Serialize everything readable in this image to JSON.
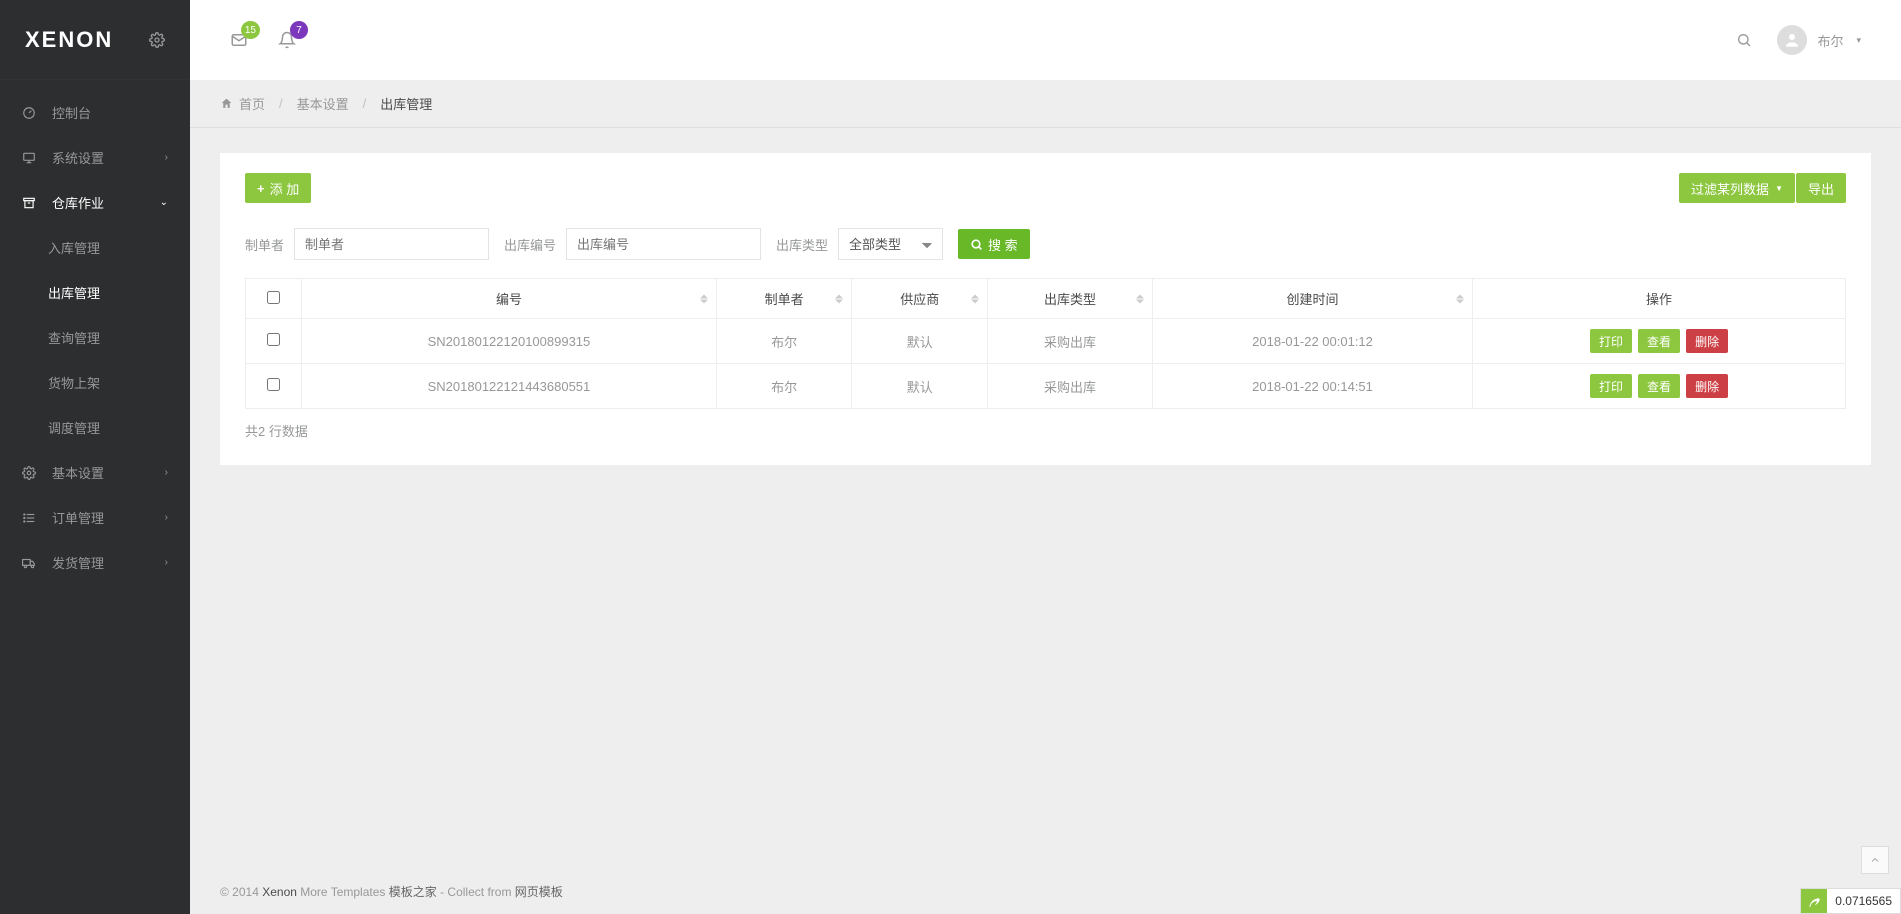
{
  "brand": "XENON",
  "notifications": {
    "mail_count": "15",
    "bell_count": "7"
  },
  "user": {
    "name": "布尔"
  },
  "sidebar": {
    "items": [
      {
        "icon": "gauge",
        "label": "控制台",
        "chevron": false
      },
      {
        "icon": "monitor",
        "label": "系统设置",
        "chevron": true
      },
      {
        "icon": "archive",
        "label": "仓库作业",
        "chevron": true,
        "open": true,
        "children": [
          {
            "label": "入库管理"
          },
          {
            "label": "出库管理",
            "active": true
          },
          {
            "label": "查询管理"
          },
          {
            "label": "货物上架"
          },
          {
            "label": "调度管理"
          }
        ]
      },
      {
        "icon": "gear",
        "label": "基本设置",
        "chevron": true
      },
      {
        "icon": "list",
        "label": "订单管理",
        "chevron": true
      },
      {
        "icon": "truck",
        "label": "发货管理",
        "chevron": true
      }
    ]
  },
  "breadcrumb": {
    "home": "首页",
    "mid": "基本设置",
    "current": "出库管理"
  },
  "toolbar": {
    "add": "添 加",
    "filter": "过滤某列数据",
    "export": "导出"
  },
  "filters": {
    "creator_label": "制单者",
    "creator_placeholder": "制单者",
    "code_label": "出库编号",
    "code_placeholder": "出库编号",
    "type_label": "出库类型",
    "type_selected": "全部类型",
    "search_btn": "搜 索"
  },
  "table": {
    "headers": {
      "code": "编号",
      "creator": "制单者",
      "supplier": "供应商",
      "type": "出库类型",
      "created": "创建时间",
      "actions": "操作"
    },
    "rows": [
      {
        "code": "SN20180122120100899315",
        "creator": "布尔",
        "supplier": "默认",
        "type": "采购出库",
        "created": "2018-01-22 00:01:12"
      },
      {
        "code": "SN20180122121443680551",
        "creator": "布尔",
        "supplier": "默认",
        "type": "采购出库",
        "created": "2018-01-22 00:14:51"
      }
    ],
    "action_labels": {
      "print": "打印",
      "view": "查看",
      "delete": "删除"
    },
    "total_text": "共2 行数据"
  },
  "footer": {
    "copyright": "© 2014 ",
    "brand": "Xenon",
    "more": " More Templates ",
    "link1": "模板之家",
    "collect": " - Collect from ",
    "link2": "网页模板"
  },
  "debug": {
    "time": "0.0716565"
  }
}
